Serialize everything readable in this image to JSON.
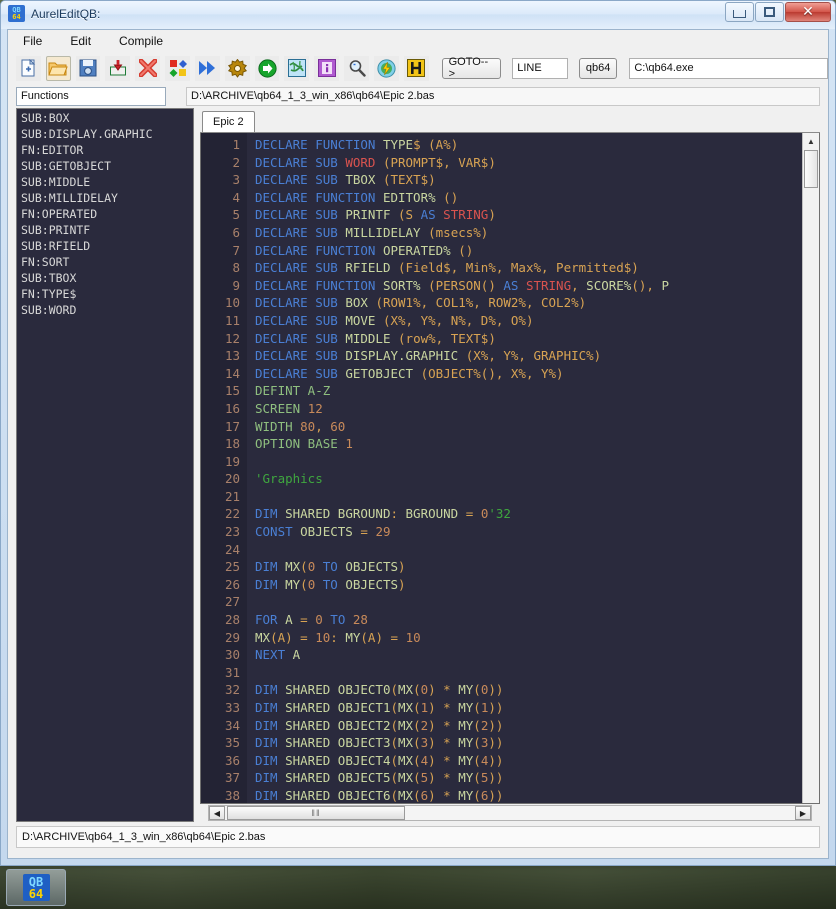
{
  "window": {
    "title": "AurelEditQB:",
    "icon": "qb64-icon",
    "ghost_labels": [
      "",
      ""
    ],
    "controls": {
      "minimize": "minimize-button",
      "maximize": "maximize-button",
      "close": "close-button",
      "close_glyph": "✕"
    }
  },
  "menu": {
    "items": [
      "File",
      "Edit",
      "Compile"
    ]
  },
  "toolbar": {
    "icons": [
      {
        "name": "new-file-icon",
        "selected": false
      },
      {
        "name": "open-folder-icon",
        "selected": true
      },
      {
        "name": "save-disk-icon",
        "selected": false
      },
      {
        "name": "import-download-icon",
        "selected": false
      },
      {
        "name": "close-delete-icon",
        "selected": false
      },
      {
        "name": "colors-palette-icon",
        "selected": false
      },
      {
        "name": "fast-forward-icon",
        "selected": false
      },
      {
        "name": "settings-gear-icon",
        "selected": false
      },
      {
        "name": "run-arrow-icon",
        "selected": false
      },
      {
        "name": "globe-web-icon",
        "selected": false
      },
      {
        "name": "info-icon",
        "selected": false
      },
      {
        "name": "search-magnifier-icon",
        "selected": false
      },
      {
        "name": "lightning-bolt-icon",
        "selected": false
      },
      {
        "name": "help-h-icon",
        "selected": false
      }
    ],
    "goto_button": "GOTO-->",
    "line_field": "LINE",
    "qb64_button": "qb64",
    "exe_path": "C:\\qb64.exe"
  },
  "functions_panel": {
    "label": "Functions",
    "items": [
      "SUB:BOX",
      "SUB:DISPLAY.GRAPHIC",
      "FN:EDITOR",
      "SUB:GETOBJECT",
      "SUB:MIDDLE",
      "SUB:MILLIDELAY",
      "FN:OPERATED",
      "SUB:PRINTF",
      "SUB:RFIELD",
      "FN:SORT",
      "SUB:TBOX",
      "FN:TYPE$",
      "SUB:WORD"
    ]
  },
  "editor": {
    "path_bar": "D:\\ARCHIVE\\qb64_1_3_win_x86\\qb64\\Epic 2.bas",
    "tabs": [
      {
        "label": "Epic 2",
        "active": true
      }
    ],
    "first_line": 1,
    "last_line": 38,
    "scroll_hthumb_glyph": "‖‖",
    "lines": [
      {
        "n": 1,
        "tokens": [
          [
            "k",
            "DECLARE "
          ],
          [
            "k",
            "FUNCTION "
          ],
          [
            "id",
            "TYPE"
          ],
          [
            "p",
            "$ (A%)"
          ]
        ]
      },
      {
        "n": 2,
        "tokens": [
          [
            "k",
            "DECLARE "
          ],
          [
            "k",
            "SUB "
          ],
          [
            "t",
            "WORD "
          ],
          [
            "p",
            "(PROMPT$, VAR$)"
          ]
        ]
      },
      {
        "n": 3,
        "tokens": [
          [
            "k",
            "DECLARE "
          ],
          [
            "k",
            "SUB "
          ],
          [
            "id",
            "TBOX "
          ],
          [
            "p",
            "(TEXT$)"
          ]
        ]
      },
      {
        "n": 4,
        "tokens": [
          [
            "k",
            "DECLARE "
          ],
          [
            "k",
            "FUNCTION "
          ],
          [
            "id",
            "EDITOR% "
          ],
          [
            "p",
            "()"
          ]
        ]
      },
      {
        "n": 5,
        "tokens": [
          [
            "k",
            "DECLARE "
          ],
          [
            "k",
            "SUB "
          ],
          [
            "id",
            "PRINTF "
          ],
          [
            "p",
            "(S "
          ],
          [
            "k",
            "AS "
          ],
          [
            "t",
            "STRING"
          ],
          [
            "p",
            ")"
          ]
        ]
      },
      {
        "n": 6,
        "tokens": [
          [
            "k",
            "DECLARE "
          ],
          [
            "k",
            "SUB "
          ],
          [
            "id",
            "MILLIDELAY "
          ],
          [
            "p",
            "(msecs%)"
          ]
        ]
      },
      {
        "n": 7,
        "tokens": [
          [
            "k",
            "DECLARE "
          ],
          [
            "k",
            "FUNCTION "
          ],
          [
            "id",
            "OPERATED% "
          ],
          [
            "p",
            "()"
          ]
        ]
      },
      {
        "n": 8,
        "tokens": [
          [
            "k",
            "DECLARE "
          ],
          [
            "k",
            "SUB "
          ],
          [
            "id",
            "RFIELD "
          ],
          [
            "p",
            "(Field$, Min%, Max%, Permitted$)"
          ]
        ]
      },
      {
        "n": 9,
        "tokens": [
          [
            "k",
            "DECLARE "
          ],
          [
            "k",
            "FUNCTION "
          ],
          [
            "id",
            "SORT% "
          ],
          [
            "p",
            "(PERSON() "
          ],
          [
            "k",
            "AS "
          ],
          [
            "t",
            "STRING"
          ],
          [
            "p",
            ", "
          ],
          [
            "id",
            "SCORE%"
          ],
          [
            "p",
            "(), "
          ],
          [
            "id",
            "P"
          ]
        ]
      },
      {
        "n": 10,
        "tokens": [
          [
            "k",
            "DECLARE "
          ],
          [
            "k",
            "SUB "
          ],
          [
            "id",
            "BOX "
          ],
          [
            "p",
            "(ROW1%, COL1%, ROW2%, COL2%)"
          ]
        ]
      },
      {
        "n": 11,
        "tokens": [
          [
            "k",
            "DECLARE "
          ],
          [
            "k",
            "SUB "
          ],
          [
            "id",
            "MOVE "
          ],
          [
            "p",
            "(X%, Y%, N%, D%, O%)"
          ]
        ]
      },
      {
        "n": 12,
        "tokens": [
          [
            "k",
            "DECLARE "
          ],
          [
            "k",
            "SUB "
          ],
          [
            "id",
            "MIDDLE "
          ],
          [
            "p",
            "(row%, TEXT$)"
          ]
        ]
      },
      {
        "n": 13,
        "tokens": [
          [
            "k",
            "DECLARE "
          ],
          [
            "k",
            "SUB "
          ],
          [
            "id",
            "DISPLAY.GRAPHIC "
          ],
          [
            "p",
            "(X%, Y%, GRAPHIC%)"
          ]
        ]
      },
      {
        "n": 14,
        "tokens": [
          [
            "k",
            "DECLARE "
          ],
          [
            "k",
            "SUB "
          ],
          [
            "id",
            "GETOBJECT "
          ],
          [
            "p",
            "(OBJECT%(), X%, Y%)"
          ]
        ]
      },
      {
        "n": 15,
        "tokens": [
          [
            "g",
            "DEFINT A-Z"
          ]
        ]
      },
      {
        "n": 16,
        "tokens": [
          [
            "g",
            "SCREEN "
          ],
          [
            "n",
            "12"
          ]
        ]
      },
      {
        "n": 17,
        "tokens": [
          [
            "g",
            "WIDTH "
          ],
          [
            "n",
            "80"
          ],
          [
            "p",
            ", "
          ],
          [
            "n",
            "60"
          ]
        ]
      },
      {
        "n": 18,
        "tokens": [
          [
            "g",
            "OPTION BASE "
          ],
          [
            "n",
            "1"
          ]
        ]
      },
      {
        "n": 19,
        "tokens": []
      },
      {
        "n": 20,
        "tokens": [
          [
            "c",
            "'Graphics"
          ]
        ]
      },
      {
        "n": 21,
        "tokens": []
      },
      {
        "n": 22,
        "tokens": [
          [
            "k",
            "DIM "
          ],
          [
            "id",
            "SHARED BGROUND"
          ],
          [
            "p",
            ": "
          ],
          [
            "id",
            "BGROUND "
          ],
          [
            "p",
            "= "
          ],
          [
            "n",
            "0"
          ],
          [
            "c",
            "'32"
          ]
        ]
      },
      {
        "n": 23,
        "tokens": [
          [
            "k",
            "CONST "
          ],
          [
            "id",
            "OBJECTS "
          ],
          [
            "p",
            "= "
          ],
          [
            "n",
            "29"
          ]
        ]
      },
      {
        "n": 24,
        "tokens": []
      },
      {
        "n": 25,
        "tokens": [
          [
            "k",
            "DIM "
          ],
          [
            "id",
            "MX"
          ],
          [
            "p",
            "("
          ],
          [
            "n",
            "0 "
          ],
          [
            "k",
            "TO "
          ],
          [
            "id",
            "OBJECTS"
          ],
          [
            "p",
            ")"
          ]
        ]
      },
      {
        "n": 26,
        "tokens": [
          [
            "k",
            "DIM "
          ],
          [
            "id",
            "MY"
          ],
          [
            "p",
            "("
          ],
          [
            "n",
            "0 "
          ],
          [
            "k",
            "TO "
          ],
          [
            "id",
            "OBJECTS"
          ],
          [
            "p",
            ")"
          ]
        ]
      },
      {
        "n": 27,
        "tokens": []
      },
      {
        "n": 28,
        "tokens": [
          [
            "k",
            "FOR "
          ],
          [
            "id",
            "A "
          ],
          [
            "p",
            "= "
          ],
          [
            "n",
            "0 "
          ],
          [
            "k",
            "TO "
          ],
          [
            "n",
            "28"
          ]
        ]
      },
      {
        "n": 29,
        "tokens": [
          [
            "id",
            "MX"
          ],
          [
            "p",
            "(A) = "
          ],
          [
            "n",
            "10"
          ],
          [
            "p",
            ": "
          ],
          [
            "id",
            "MY"
          ],
          [
            "p",
            "(A) = "
          ],
          [
            "n",
            "10"
          ]
        ]
      },
      {
        "n": 30,
        "tokens": [
          [
            "k",
            "NEXT "
          ],
          [
            "id",
            "A"
          ]
        ]
      },
      {
        "n": 31,
        "tokens": []
      },
      {
        "n": 32,
        "tokens": [
          [
            "k",
            "DIM "
          ],
          [
            "id",
            "SHARED OBJECT0"
          ],
          [
            "p",
            "("
          ],
          [
            "id",
            "MX"
          ],
          [
            "p",
            "("
          ],
          [
            "n",
            "0"
          ],
          [
            "p",
            ") * "
          ],
          [
            "id",
            "MY"
          ],
          [
            "p",
            "("
          ],
          [
            "n",
            "0"
          ],
          [
            "p",
            "))"
          ]
        ]
      },
      {
        "n": 33,
        "tokens": [
          [
            "k",
            "DIM "
          ],
          [
            "id",
            "SHARED OBJECT1"
          ],
          [
            "p",
            "("
          ],
          [
            "id",
            "MX"
          ],
          [
            "p",
            "("
          ],
          [
            "n",
            "1"
          ],
          [
            "p",
            ") * "
          ],
          [
            "id",
            "MY"
          ],
          [
            "p",
            "("
          ],
          [
            "n",
            "1"
          ],
          [
            "p",
            "))"
          ]
        ]
      },
      {
        "n": 34,
        "tokens": [
          [
            "k",
            "DIM "
          ],
          [
            "id",
            "SHARED OBJECT2"
          ],
          [
            "p",
            "("
          ],
          [
            "id",
            "MX"
          ],
          [
            "p",
            "("
          ],
          [
            "n",
            "2"
          ],
          [
            "p",
            ") * "
          ],
          [
            "id",
            "MY"
          ],
          [
            "p",
            "("
          ],
          [
            "n",
            "2"
          ],
          [
            "p",
            "))"
          ]
        ]
      },
      {
        "n": 35,
        "tokens": [
          [
            "k",
            "DIM "
          ],
          [
            "id",
            "SHARED OBJECT3"
          ],
          [
            "p",
            "("
          ],
          [
            "id",
            "MX"
          ],
          [
            "p",
            "("
          ],
          [
            "n",
            "3"
          ],
          [
            "p",
            ") * "
          ],
          [
            "id",
            "MY"
          ],
          [
            "p",
            "("
          ],
          [
            "n",
            "3"
          ],
          [
            "p",
            "))"
          ]
        ]
      },
      {
        "n": 36,
        "tokens": [
          [
            "k",
            "DIM "
          ],
          [
            "id",
            "SHARED OBJECT4"
          ],
          [
            "p",
            "("
          ],
          [
            "id",
            "MX"
          ],
          [
            "p",
            "("
          ],
          [
            "n",
            "4"
          ],
          [
            "p",
            ") * "
          ],
          [
            "id",
            "MY"
          ],
          [
            "p",
            "("
          ],
          [
            "n",
            "4"
          ],
          [
            "p",
            "))"
          ]
        ]
      },
      {
        "n": 37,
        "tokens": [
          [
            "k",
            "DIM "
          ],
          [
            "id",
            "SHARED OBJECT5"
          ],
          [
            "p",
            "("
          ],
          [
            "id",
            "MX"
          ],
          [
            "p",
            "("
          ],
          [
            "n",
            "5"
          ],
          [
            "p",
            ") * "
          ],
          [
            "id",
            "MY"
          ],
          [
            "p",
            "("
          ],
          [
            "n",
            "5"
          ],
          [
            "p",
            "))"
          ]
        ]
      },
      {
        "n": 38,
        "tokens": [
          [
            "k",
            "DIM "
          ],
          [
            "id",
            "SHARED OBJECT6"
          ],
          [
            "p",
            "("
          ],
          [
            "id",
            "MX"
          ],
          [
            "p",
            "("
          ],
          [
            "n",
            "6"
          ],
          [
            "p",
            ") * "
          ],
          [
            "id",
            "MY"
          ],
          [
            "p",
            "("
          ],
          [
            "n",
            "6"
          ],
          [
            "p",
            "))"
          ]
        ]
      }
    ]
  },
  "status_bar": {
    "text": "D:\\ARCHIVE\\qb64_1_3_win_x86\\qb64\\Epic 2.bas"
  },
  "taskbar": {
    "items": [
      {
        "name": "qb64-task-button",
        "icon_top": "QB",
        "icon_bottom": "64"
      }
    ]
  },
  "colors": {
    "editor_bg": "#2a2a3d",
    "gutter_bg": "#232334",
    "keyword": "#4a7fd4",
    "identifier": "#c9d6a0",
    "punctuation": "#d8a353",
    "type": "#d9534f",
    "number": "#c88a5a",
    "comment": "#3fa63f",
    "linenum": "#a8806a"
  }
}
